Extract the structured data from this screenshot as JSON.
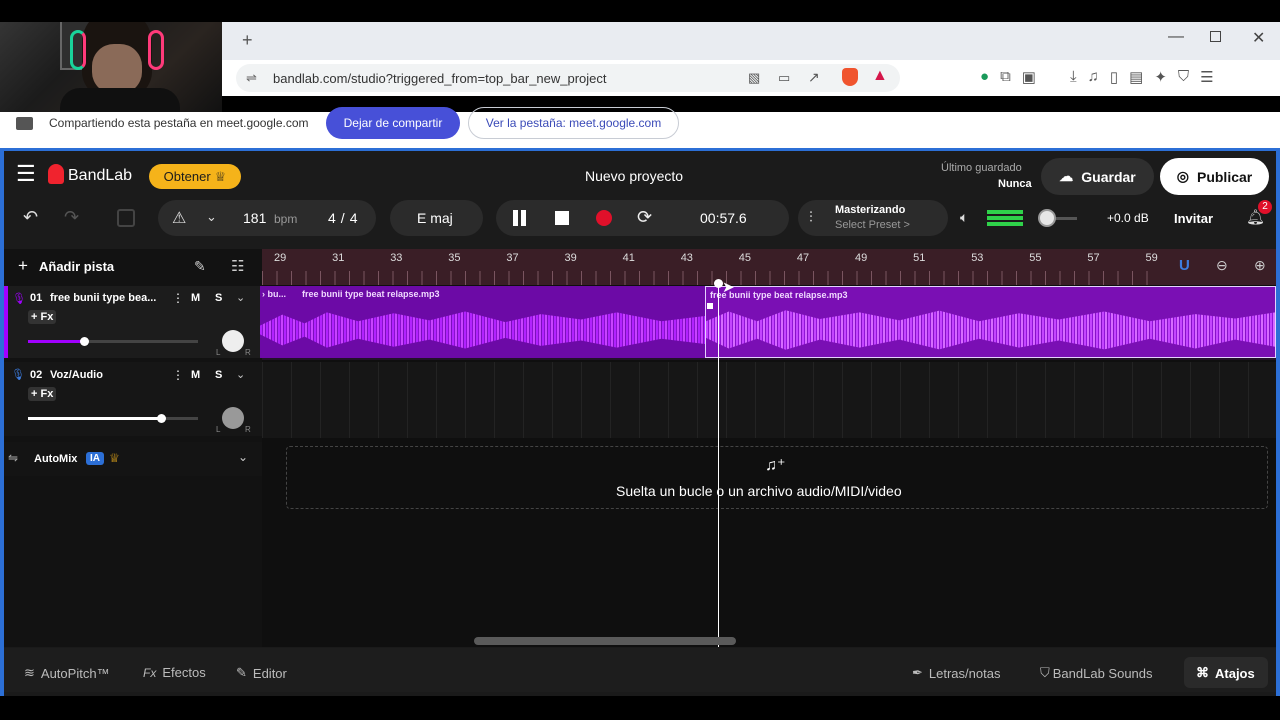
{
  "browser": {
    "url": "bandlab.com/studio?triggered_from=top_bar_new_project",
    "new_tab_glyph": "+",
    "share_notice": "Compartiendo esta pestaña en meet.google.com",
    "stop_share_label": "Dejar de compartir",
    "view_tab_label": "Ver la pestaña: meet.google.com"
  },
  "header": {
    "brand": "BandLab",
    "get_label": "Obtener",
    "project_title": "Nuevo proyecto",
    "last_saved_label": "Último guardado",
    "last_saved_value": "Nunca",
    "save_label": "Guardar",
    "publish_label": "Publicar"
  },
  "toolbar": {
    "bpm_value": "181",
    "bpm_unit": "bpm",
    "time_sig_num": "4",
    "time_sig_sep": "/",
    "time_sig_den": "4",
    "key": "E maj",
    "time": "00:57.6",
    "mastering_label": "Masterizando",
    "preset_label": "Select Preset >",
    "volume_db": "+0.0 dB",
    "invite_label": "Invitar",
    "notif_count": "2"
  },
  "tracks_panel": {
    "add_track_label": "Añadir pista",
    "tracks": [
      {
        "num": "01",
        "name": "free bunii type bea...",
        "fx": "+ Fx",
        "mute": "M",
        "solo": "S",
        "left": "L",
        "right": "R",
        "volume": 0.33
      },
      {
        "num": "02",
        "name": "Voz/Audio",
        "fx": "+ Fx",
        "mute": "M",
        "solo": "S",
        "left": "L",
        "right": "R",
        "volume": 0.78
      }
    ],
    "automix_label": "AutoMix",
    "ai_badge": "IA"
  },
  "ruler": {
    "marks": [
      "29",
      "31",
      "33",
      "35",
      "37",
      "39",
      "41",
      "43",
      "45",
      "47",
      "49",
      "51",
      "53",
      "55",
      "57",
      "59"
    ]
  },
  "clips": {
    "clip_a_prefix": "› bu...",
    "clip_a_name": "free bunii type beat relapse.mp3",
    "clip_b_name": "free bunii type beat relapse.mp3"
  },
  "drop_zone": {
    "message": "Suelta un bucle o un archivo audio/MIDI/video"
  },
  "bottom_bar": {
    "autopitch": "AutoPitch™",
    "effects_prefix": "Fx",
    "effects": "Efectos",
    "editor": "Editor",
    "lyrics": "Letras/notas",
    "sounds": "BandLab Sounds",
    "shortcuts": "Atajos"
  },
  "colors": {
    "accent_purple": "#a100ff",
    "clip_purple": "#7a0fb4",
    "record_red": "#e0102a",
    "get_yellow": "#f5b31a",
    "stop_share_blue": "#4750d8",
    "frame_blue": "#2c6fd6"
  }
}
